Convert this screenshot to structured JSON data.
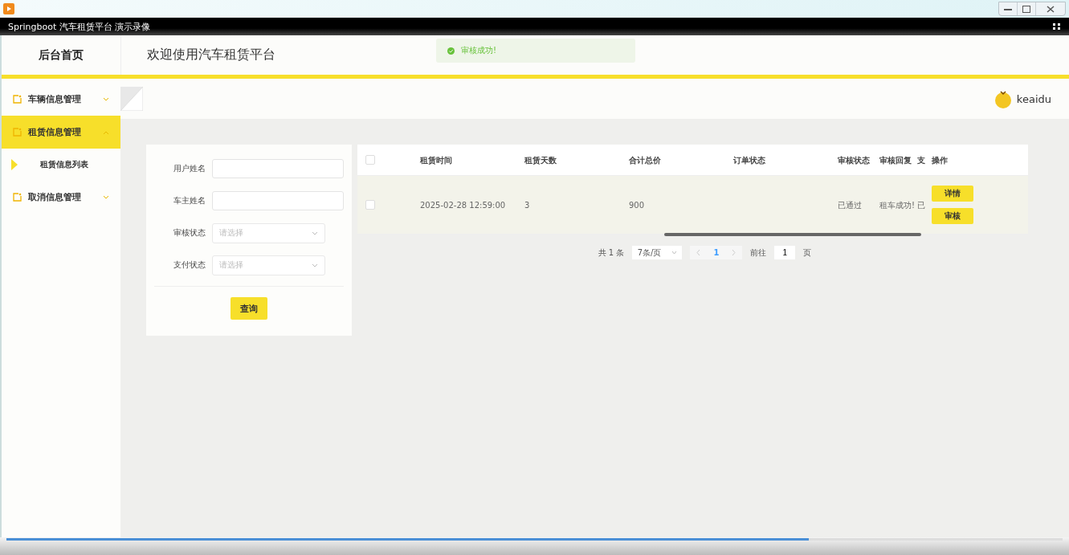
{
  "player": {
    "title": "Springboot 汽车租赁平台 演示录像",
    "progress": {
      "level": 0.76
    }
  },
  "header": {
    "home": "后台首页",
    "title": "欢迎使用汽车租赁平台",
    "toast": "审核成功!"
  },
  "sidebar": {
    "items": [
      {
        "label": "车辆信息管理",
        "expanded": false,
        "selected": false
      },
      {
        "label": "租赁信息管理",
        "expanded": true,
        "selected": true,
        "children": [
          {
            "label": "租赁信息列表",
            "selected": true
          }
        ]
      },
      {
        "label": "取消信息管理",
        "expanded": false,
        "selected": false
      }
    ]
  },
  "user": {
    "name": "keaidu"
  },
  "filters": [
    {
      "kind": "input",
      "label": "用户姓名"
    },
    {
      "kind": "input",
      "label": "车主姓名"
    },
    {
      "kind": "select",
      "label": "审核状态",
      "placeholder": "请选择"
    },
    {
      "kind": "select",
      "label": "支付状态",
      "placeholder": "请选择"
    }
  ],
  "search_button": "查询",
  "table": {
    "select_all": {
      "checked": false
    },
    "columns": [
      "租赁时间",
      "租赁天数",
      "合计总价",
      "订单状态",
      "审核状态",
      "审核回复",
      "支",
      "操作"
    ],
    "rows": [
      {
        "checked": false,
        "cells": {
          "rent_time": "2025-02-28 12:59:00",
          "days": "3",
          "total": "900",
          "audit_status": "已通过",
          "audit_reply": "租车成功!",
          "column_8": "已"
        },
        "actions": [
          "详情",
          "审核"
        ]
      }
    ]
  },
  "pagination": {
    "total": "共 1 条",
    "page_size": "7条/页",
    "current": "1",
    "goto": "前往",
    "goto_value": "1",
    "page_unit": "页"
  }
}
